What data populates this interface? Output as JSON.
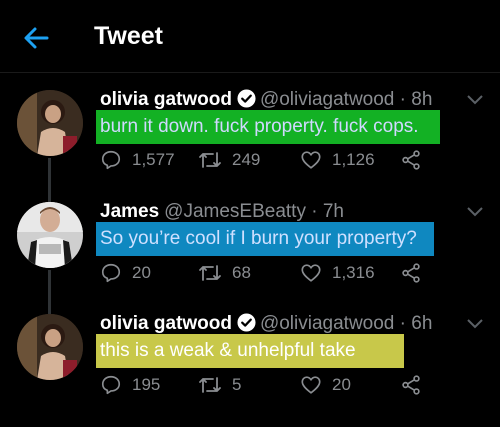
{
  "header": {
    "title": "Tweet"
  },
  "tweets": [
    {
      "name": "olivia gatwood",
      "handle": "@oliviagatwood",
      "time": " · 8h",
      "text": "burn it down. fuck property. fuck cops.",
      "highlight": "#13b124",
      "replies": "1,577",
      "retweets": "249",
      "likes": "1,126",
      "verified": true
    },
    {
      "name": "James",
      "handle": "@JamesEBeatty",
      "time": " · 7h",
      "text": "So you’re cool if I burn your property?",
      "highlight": "#0f88c0",
      "replies": "20",
      "retweets": "68",
      "likes": "1,316",
      "verified": false
    },
    {
      "name": "olivia gatwood",
      "handle": "@oliviagatwood",
      "time": " · 6h",
      "text": "this is a weak & unhelpful take",
      "highlight": "#c8c84a",
      "replies": "195",
      "retweets": "5",
      "likes": "20",
      "verified": true
    }
  ],
  "colors": {
    "background": "#000000",
    "secondary_text": "#8a8d91",
    "accent": "#1da1f2"
  }
}
